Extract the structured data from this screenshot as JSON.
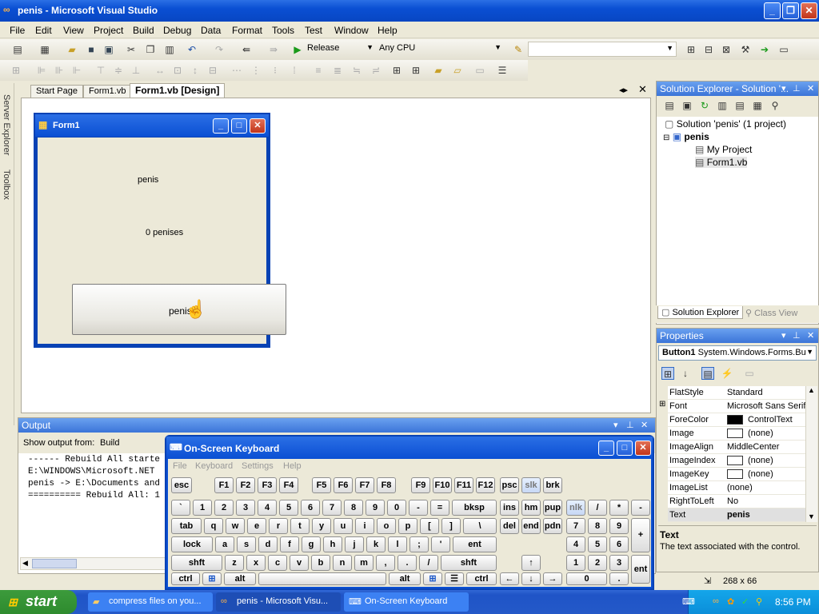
{
  "window": {
    "title": "penis - Microsoft Visual Studio"
  },
  "menu": [
    "File",
    "Edit",
    "View",
    "Project",
    "Build",
    "Debug",
    "Data",
    "Format",
    "Tools",
    "Test",
    "Window",
    "Help"
  ],
  "toolbar": {
    "config": "Release",
    "platform": "Any CPU",
    "find": ""
  },
  "sidedock": {
    "server_explorer": "Server Explorer",
    "toolbox": "Toolbox"
  },
  "tabs": [
    {
      "label": "Start Page"
    },
    {
      "label": "Form1.vb"
    },
    {
      "label": "Form1.vb [Design]"
    }
  ],
  "form": {
    "title": "Form1",
    "label1": "penis",
    "label2": "0 penises",
    "button": "penis"
  },
  "solution_explorer": {
    "title": "Solution Explorer - Solution '...",
    "solution": "Solution 'penis' (1 project)",
    "project": "penis",
    "items": [
      "My Project",
      "Form1.vb"
    ],
    "tabs": [
      "Solution Explorer",
      "Class View"
    ]
  },
  "properties": {
    "title": "Properties",
    "object": "Button1",
    "object_type": "System.Windows.Forms.Bu",
    "rows": [
      {
        "k": "FlatStyle",
        "v": "Standard"
      },
      {
        "k": "Font",
        "v": "Microsoft Sans Serif"
      },
      {
        "k": "ForeColor",
        "v": "ControlText"
      },
      {
        "k": "Image",
        "v": "(none)"
      },
      {
        "k": "ImageAlign",
        "v": "MiddleCenter"
      },
      {
        "k": "ImageIndex",
        "v": "(none)"
      },
      {
        "k": "ImageKey",
        "v": "(none)"
      },
      {
        "k": "ImageList",
        "v": "(none)"
      },
      {
        "k": "RightToLeft",
        "v": "No"
      },
      {
        "k": "Text",
        "v": "penis"
      }
    ],
    "desc_title": "Text",
    "desc": "The text associated with the control."
  },
  "status": {
    "size": "268 x 66"
  },
  "output": {
    "title": "Output",
    "show_from_label": "Show output from:",
    "show_from_value": "Build",
    "lines": [
      "------ Rebuild All starte",
      "E:\\WINDOWS\\Microsoft.NET",
      "penis -> E:\\Documents and",
      "========== Rebuild All: 1"
    ]
  },
  "keyboard": {
    "title": "On-Screen Keyboard",
    "menu": [
      "File",
      "Keyboard",
      "Settings",
      "Help"
    ],
    "rows": [
      [
        "esc",
        "F1",
        "F2",
        "F3",
        "F4",
        "F5",
        "F6",
        "F7",
        "F8",
        "F9",
        "F10",
        "F11",
        "F12",
        "psc",
        "slk",
        "brk"
      ],
      [
        "`",
        "1",
        "2",
        "3",
        "4",
        "5",
        "6",
        "7",
        "8",
        "9",
        "0",
        "-",
        "=",
        "bksp",
        "ins",
        "hm",
        "pup",
        "nlk",
        "/",
        "*",
        "-"
      ],
      [
        "tab",
        "q",
        "w",
        "e",
        "r",
        "t",
        "y",
        "u",
        "i",
        "o",
        "p",
        "[",
        "]",
        "\\",
        "del",
        "end",
        "pdn",
        "7",
        "8",
        "9",
        "+"
      ],
      [
        "lock",
        "a",
        "s",
        "d",
        "f",
        "g",
        "h",
        "j",
        "k",
        "l",
        ";",
        "'",
        "ent",
        "4",
        "5",
        "6"
      ],
      [
        "shft",
        "z",
        "x",
        "c",
        "v",
        "b",
        "n",
        "m",
        ",",
        ".",
        "/",
        "shft",
        "↑",
        "1",
        "2",
        "3",
        "ent"
      ],
      [
        "ctrl",
        "alt",
        "alt",
        "ctrl",
        "←",
        "↓",
        "→",
        "0",
        "."
      ]
    ]
  },
  "taskbar": {
    "start": "start",
    "tasks": [
      "compress files on you...",
      "penis - Microsoft Visu...",
      "On-Screen Keyboard"
    ],
    "time": "8:56 PM"
  }
}
